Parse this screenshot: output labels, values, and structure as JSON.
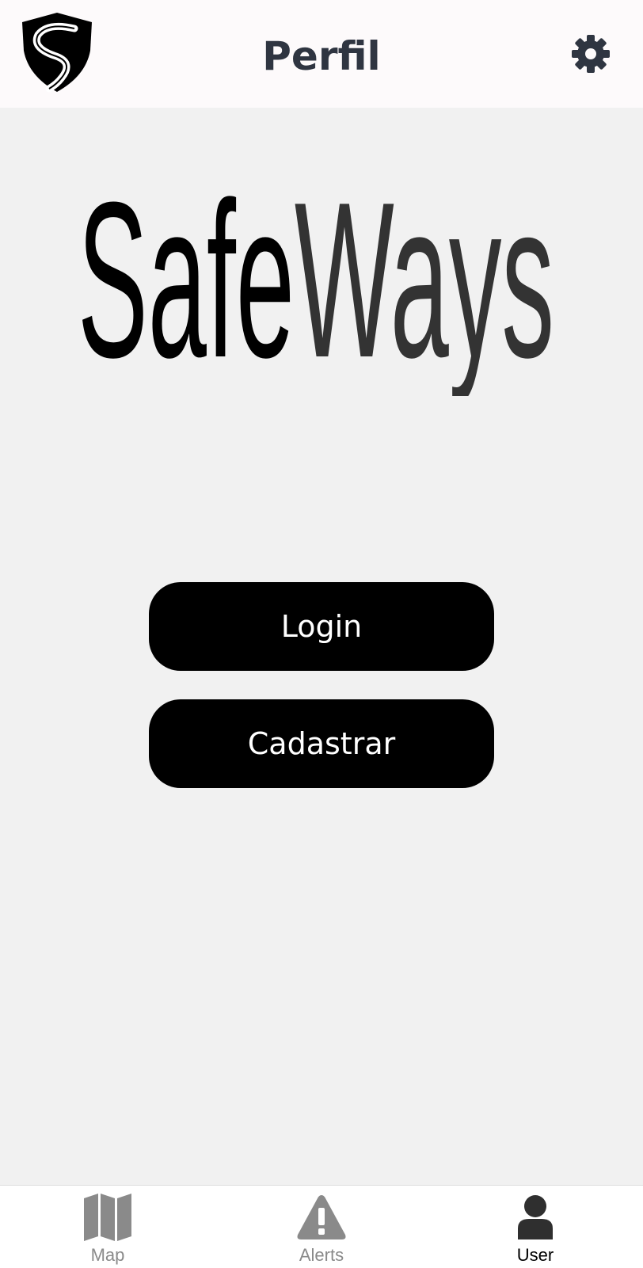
{
  "header": {
    "title": "Perfil",
    "logo_icon": "shield-road-logo-icon",
    "settings_icon": "gear-icon"
  },
  "brand": {
    "part1": "Safe",
    "part2": "Ways",
    "colors": {
      "part1": "#000000",
      "part2": "#333333"
    }
  },
  "actions": {
    "login_label": "Login",
    "register_label": "Cadastrar"
  },
  "tabbar": {
    "active_color": "#000000",
    "inactive_color": "#8a8a8a",
    "items": [
      {
        "label": "Map",
        "icon": "map-icon",
        "active": false
      },
      {
        "label": "Alerts",
        "icon": "alert-icon",
        "active": false
      },
      {
        "label": "User",
        "icon": "user-icon",
        "active": true
      }
    ]
  }
}
